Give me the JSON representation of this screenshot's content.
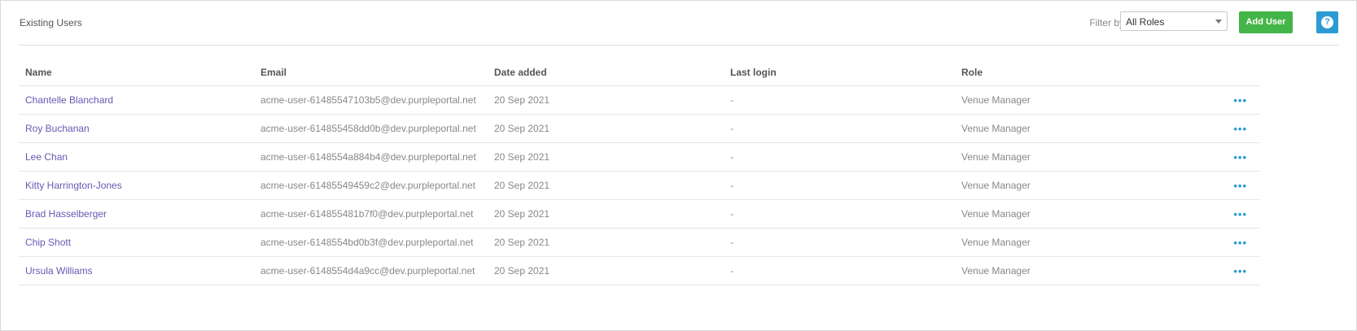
{
  "header": {
    "title": "Existing Users",
    "filter_label": "Filter by",
    "filter_value": "All Roles",
    "add_button": "Add User",
    "help_glyph": "?"
  },
  "table": {
    "columns": [
      "Name",
      "Email",
      "Date added",
      "Last login",
      "Role"
    ],
    "rows": [
      {
        "name": "Chantelle Blanchard",
        "email": "acme-user-61485547103b5@dev.purpleportal.net",
        "date": "20 Sep 2021",
        "last": "-",
        "role": "Venue Manager",
        "menu": "•••"
      },
      {
        "name": "Roy Buchanan",
        "email": "acme-user-614855458dd0b@dev.purpleportal.net",
        "date": "20 Sep 2021",
        "last": "-",
        "role": "Venue Manager",
        "menu": "•••"
      },
      {
        "name": "Lee Chan",
        "email": "acme-user-6148554a884b4@dev.purpleportal.net",
        "date": "20 Sep 2021",
        "last": "-",
        "role": "Venue Manager",
        "menu": "•••"
      },
      {
        "name": "Kitty Harrington-Jones",
        "email": "acme-user-61485549459c2@dev.purpleportal.net",
        "date": "20 Sep 2021",
        "last": "-",
        "role": "Venue Manager",
        "menu": "•••"
      },
      {
        "name": "Brad Hasselberger",
        "email": "acme-user-614855481b7f0@dev.purpleportal.net",
        "date": "20 Sep 2021",
        "last": "-",
        "role": "Venue Manager",
        "menu": "•••"
      },
      {
        "name": "Chip Shott",
        "email": "acme-user-6148554bd0b3f@dev.purpleportal.net",
        "date": "20 Sep 2021",
        "last": "-",
        "role": "Venue Manager",
        "menu": "•••"
      },
      {
        "name": "Ursula Williams",
        "email": "acme-user-6148554d4a9cc@dev.purpleportal.net",
        "date": "20 Sep 2021",
        "last": "-",
        "role": "Venue Manager",
        "menu": "•••"
      }
    ]
  },
  "colors": {
    "accent_green": "#44b649",
    "accent_blue": "#2d9bd3",
    "link_purple": "#6a57b3"
  },
  "icons": {
    "help": "help-icon",
    "dropdown": "chevron-down-icon",
    "row_menu": "more-horizontal-icon"
  }
}
